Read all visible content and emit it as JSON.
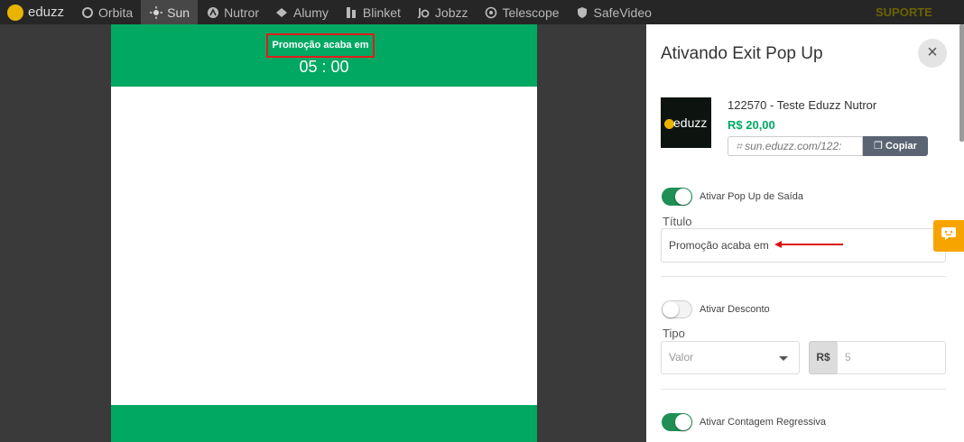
{
  "nav": {
    "logo": "eduzz",
    "items": [
      {
        "label": "Orbita",
        "icon": "orbita-icon"
      },
      {
        "label": "Sun",
        "icon": "sun-icon"
      },
      {
        "label": "Nutror",
        "icon": "nutror-icon"
      },
      {
        "label": "Alumy",
        "icon": "alumy-icon"
      },
      {
        "label": "Blinket",
        "icon": "blinket-icon"
      },
      {
        "label": "Jobzz",
        "icon": "jobzz-icon"
      },
      {
        "label": "Telescope",
        "icon": "telescope-icon"
      },
      {
        "label": "SafeVideo",
        "icon": "safevideo-icon"
      }
    ],
    "active": "Sun",
    "support": "SUPORTE"
  },
  "preview": {
    "title": "Promoção acaba em",
    "timer": "05 : 00",
    "accent": "#00a862",
    "highlight": "#e01c1c"
  },
  "panel": {
    "title": "Ativando Exit Pop Up",
    "close": "×",
    "product": {
      "thumb_text": "eduzz",
      "name": "122570 - Teste Eduzz Nutror",
      "price": "R$ 20,00",
      "link": "sun.eduzz.com/122:",
      "copy_label": "Copiar"
    },
    "exit_popup": {
      "label": "Ativar Pop Up de Saída",
      "enabled": true
    },
    "title_field": {
      "label": "Título",
      "value": "Promoção acaba em"
    },
    "discount": {
      "label": "Ativar Desconto",
      "enabled": false
    },
    "type_field": {
      "label": "Tipo",
      "placeholder": "Valor",
      "currency": "R$",
      "amount_placeholder": "5"
    },
    "countdown": {
      "label": "Ativar Contagem Regressiva",
      "enabled": true
    }
  }
}
